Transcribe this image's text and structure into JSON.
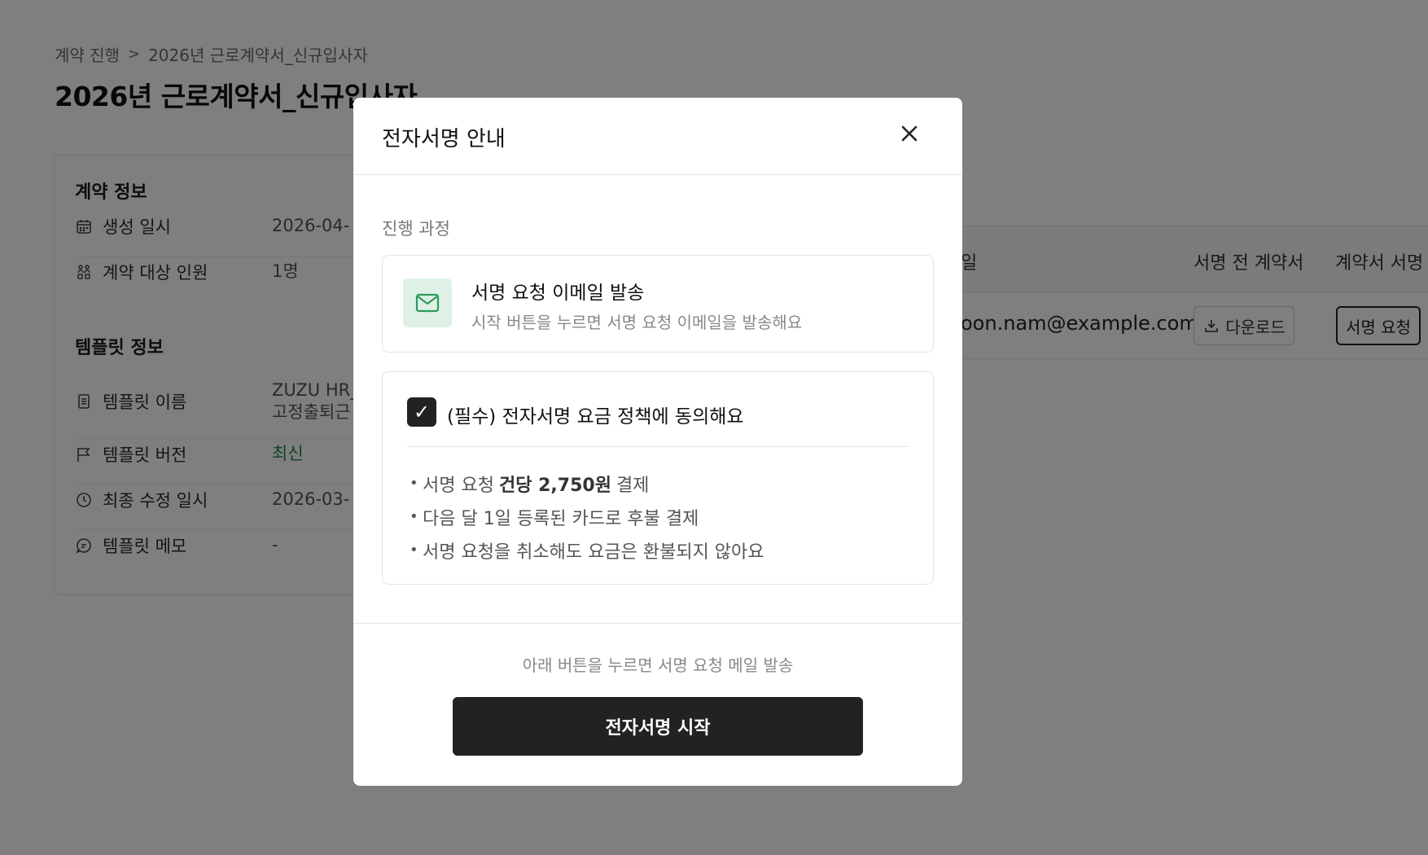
{
  "breadcrumb": {
    "parent": "계약 진행",
    "separator": ">",
    "current": "2026년 근로계약서_신규입사자"
  },
  "page_title": "2026년 근로계약서_신규입사자",
  "contract_info": {
    "title": "계약 정보",
    "created_label": "생성 일시",
    "created_value": "2026-04-",
    "target_label": "계약 대상 인원",
    "target_value": "1명"
  },
  "template_info": {
    "title": "템플릿 정보",
    "name_label": "템플릿 이름",
    "name_value_line1": "ZUZU HR_",
    "name_value_line2": "고정출퇴근",
    "version_label": "템플릿 버전",
    "version_value": "최신",
    "modified_label": "최종 수정 일시",
    "modified_value": "2026-03-",
    "memo_label": "템플릿 메모",
    "memo_value": "-"
  },
  "table": {
    "col_email": "일",
    "col_before_contract": "서명 전 계약서",
    "col_contract_sign": "계약서 서명",
    "row_email": "oon.nam@example.com",
    "download_label": "다운로드",
    "request_label": "서명 요청"
  },
  "modal": {
    "title": "전자서명 안내",
    "step_label": "진행 과정",
    "step_title": "서명 요청 이메일 발송",
    "step_desc": "시작 버튼을 누르면 서명 요청 이메일을 발송해요",
    "checkbox_mark": "✓",
    "agree_text": "(필수) 전자서명 요금 정책에 동의해요",
    "bullet1_pre": "서명 요청",
    "bullet1_bold": "건당 2,750원",
    "bullet1_post": "결제",
    "bullet2": "다음 달 1일 등록된 카드로 후불 결제",
    "bullet3": "서명 요청을 취소해도 요금은 환불되지 않아요",
    "footer_note": "아래 버튼을 누르면 서명 요청 메일 발송",
    "start_button": "전자서명 시작"
  },
  "colors": {
    "overlay": "#000000",
    "primary_button": "#222222",
    "accent_green": "#1f8a4c",
    "mail_icon_bg": "#dff1e6"
  }
}
